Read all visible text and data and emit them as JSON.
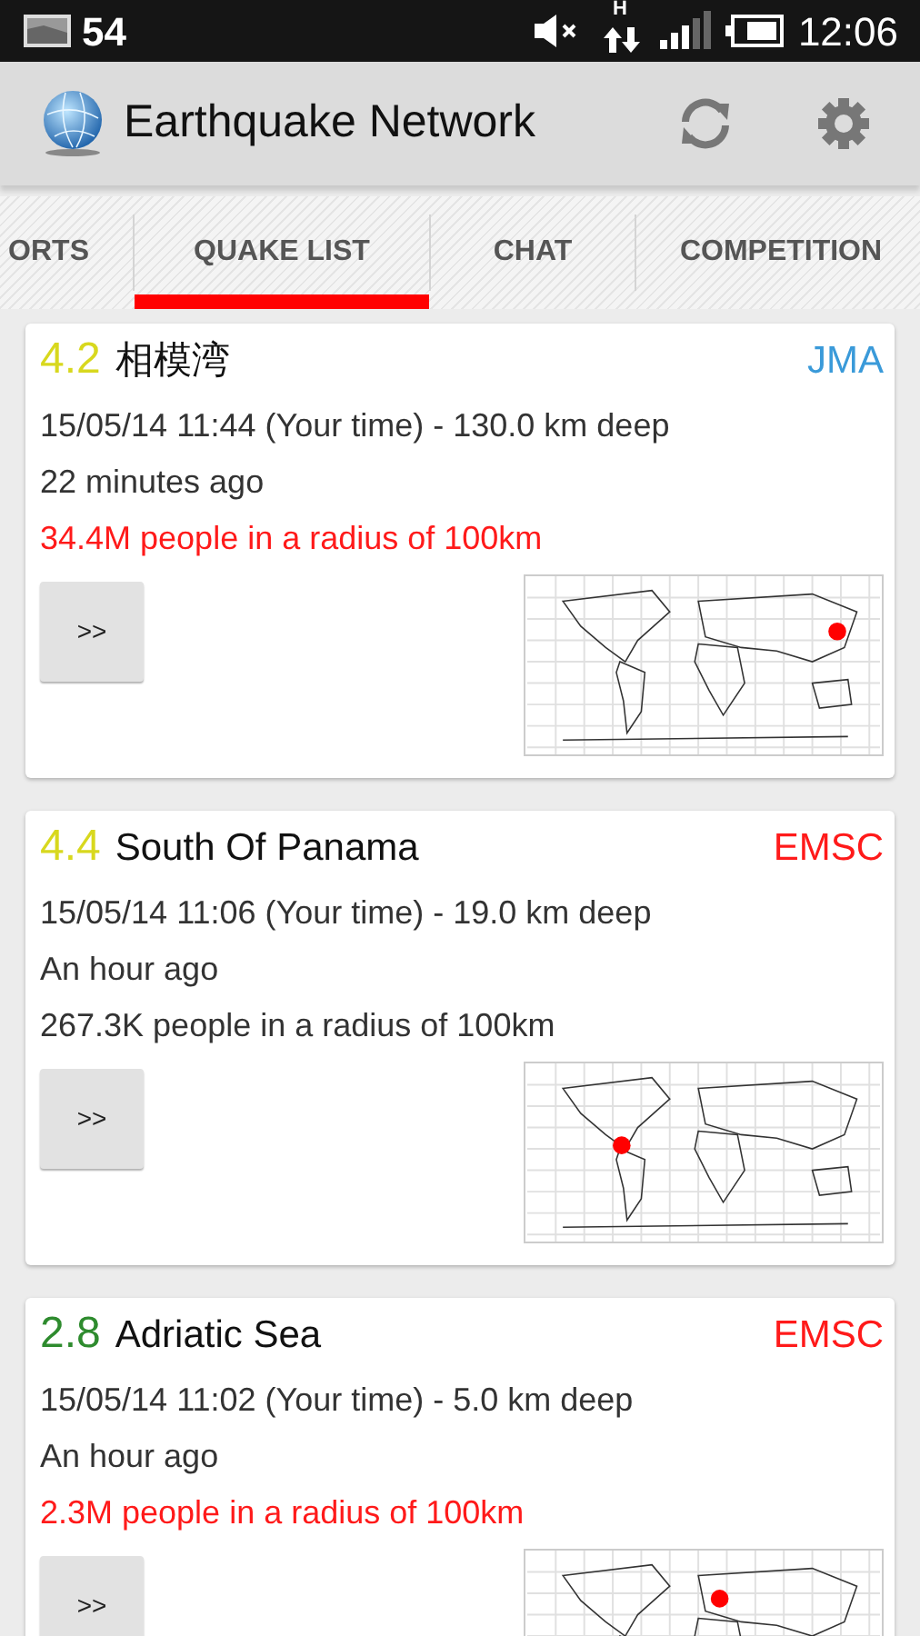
{
  "status_bar": {
    "notification_count": "54",
    "data_type": "H",
    "time": "12:06"
  },
  "app_bar": {
    "title": "Earthquake Network"
  },
  "tabs": [
    {
      "label": "ORTS",
      "selected": false
    },
    {
      "label": "QUAKE LIST",
      "selected": true
    },
    {
      "label": "CHAT",
      "selected": false
    },
    {
      "label": "COMPETITION",
      "selected": false
    }
  ],
  "quakes": [
    {
      "magnitude": {
        "text": "4.2",
        "color": "#d8d81e"
      },
      "place": "相模湾",
      "source": {
        "text": "JMA",
        "color": "#3a9ad9"
      },
      "time": "15/05/14 11:44 (Your time) - 130.0 km deep",
      "ago": "22 minutes ago",
      "population": {
        "text": "34.4M people in a radius of 100km",
        "color": "#ff1a1a"
      },
      "button": ">>"
    },
    {
      "magnitude": {
        "text": "4.4",
        "color": "#d8d81e"
      },
      "place": "South Of Panama",
      "source": {
        "text": "EMSC",
        "color": "#ff1a1a"
      },
      "time": "15/05/14 11:06 (Your time) - 19.0 km deep",
      "ago": "An hour ago",
      "population": {
        "text": "267.3K people in a radius of 100km",
        "color": "#333333"
      },
      "button": ">>"
    },
    {
      "magnitude": {
        "text": "2.8",
        "color": "#2e8b2e"
      },
      "place": "Adriatic Sea",
      "source": {
        "text": "EMSC",
        "color": "#ff1a1a"
      },
      "time": "15/05/14 11:02 (Your time) - 5.0 km deep",
      "ago": "An hour ago",
      "population": {
        "text": "2.3M people in a radius of 100km",
        "color": "#ff1a1a"
      },
      "button": ">>"
    }
  ]
}
